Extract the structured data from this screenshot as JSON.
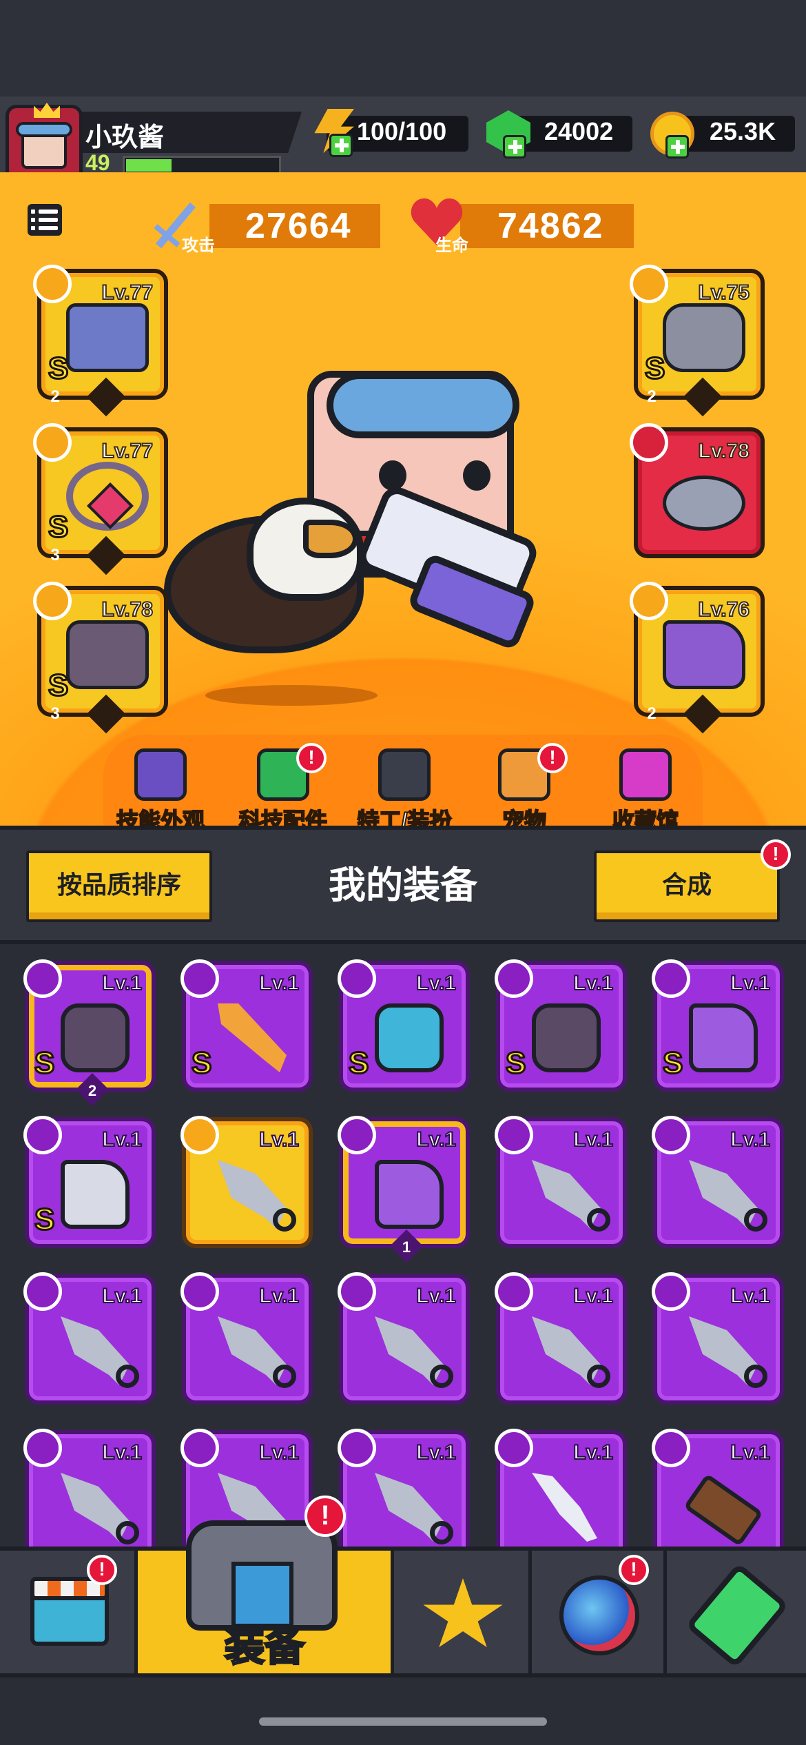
{
  "player": {
    "name": "小玖酱",
    "level": "49",
    "xp_fraction": 0.3
  },
  "resources": {
    "energy": "100/100",
    "gems": "24002",
    "coins": "25.3K"
  },
  "stats": {
    "attack_label": "攻击",
    "attack_value": "27664",
    "hp_label": "生命",
    "hp_value": "74862"
  },
  "equipped": [
    {
      "slot": "weapon",
      "level": "Lv.77",
      "rank": "S",
      "stars": "2",
      "frame": "yellow"
    },
    {
      "slot": "necklace",
      "level": "Lv.77",
      "rank": "S",
      "stars": "3",
      "frame": "yellow"
    },
    {
      "slot": "gloves",
      "level": "Lv.78",
      "rank": "S",
      "stars": "3",
      "frame": "yellow"
    },
    {
      "slot": "armor",
      "level": "Lv.75",
      "rank": "S",
      "stars": "2",
      "frame": "yellow"
    },
    {
      "slot": "belt",
      "level": "Lv.78",
      "rank": "",
      "stars": "",
      "frame": "red"
    },
    {
      "slot": "boots",
      "level": "Lv.76",
      "rank": "",
      "stars": "2",
      "frame": "yellow"
    }
  ],
  "features": [
    {
      "label": "技能外观",
      "icon": "skill-skin-icon",
      "alert": false
    },
    {
      "label": "科技配件",
      "icon": "tech-part-icon",
      "alert": true
    },
    {
      "label": "特工/装扮",
      "icon": "agent-icon",
      "alert": false
    },
    {
      "label": "宠物",
      "icon": "pet-icon",
      "alert": true
    },
    {
      "label": "收藏馆",
      "icon": "collection-icon",
      "alert": false
    }
  ],
  "equipment_panel": {
    "sort_button": "按品质排序",
    "title": "我的装备",
    "merge_button": "合成",
    "merge_alert": "!"
  },
  "inventory": [
    {
      "level": "Lv.1",
      "rank": "S",
      "stars": "2",
      "item": "gloves",
      "frame": "purple-gold"
    },
    {
      "level": "Lv.1",
      "rank": "S",
      "stars": "",
      "item": "sword",
      "frame": "purple"
    },
    {
      "level": "Lv.1",
      "rank": "S",
      "stars": "",
      "item": "armor",
      "frame": "purple"
    },
    {
      "level": "Lv.1",
      "rank": "S",
      "stars": "",
      "item": "gloves",
      "frame": "purple"
    },
    {
      "level": "Lv.1",
      "rank": "S",
      "stars": "",
      "item": "boots",
      "frame": "purple"
    },
    {
      "level": "Lv.1",
      "rank": "S",
      "stars": "",
      "item": "boots-white",
      "frame": "purple"
    },
    {
      "level": "Lv.1",
      "rank": "",
      "stars": "",
      "item": "kunai",
      "frame": "yellow"
    },
    {
      "level": "Lv.1",
      "rank": "",
      "stars": "1",
      "item": "boots",
      "frame": "purple-gold"
    },
    {
      "level": "Lv.1",
      "rank": "",
      "stars": "",
      "item": "kunai",
      "frame": "purple"
    },
    {
      "level": "Lv.1",
      "rank": "",
      "stars": "",
      "item": "kunai",
      "frame": "purple"
    },
    {
      "level": "Lv.1",
      "rank": "",
      "stars": "",
      "item": "kunai",
      "frame": "purple"
    },
    {
      "level": "Lv.1",
      "rank": "",
      "stars": "",
      "item": "kunai",
      "frame": "purple"
    },
    {
      "level": "Lv.1",
      "rank": "",
      "stars": "",
      "item": "kunai",
      "frame": "purple"
    },
    {
      "level": "Lv.1",
      "rank": "",
      "stars": "",
      "item": "kunai",
      "frame": "purple"
    },
    {
      "level": "Lv.1",
      "rank": "",
      "stars": "",
      "item": "kunai",
      "frame": "purple"
    },
    {
      "level": "Lv.1",
      "rank": "",
      "stars": "",
      "item": "kunai",
      "frame": "purple"
    },
    {
      "level": "Lv.1",
      "rank": "",
      "stars": "",
      "item": "kunai",
      "frame": "purple"
    },
    {
      "level": "Lv.1",
      "rank": "",
      "stars": "",
      "item": "kunai",
      "frame": "purple"
    },
    {
      "level": "Lv.1",
      "rank": "",
      "stars": "",
      "item": "blade",
      "frame": "purple"
    },
    {
      "level": "Lv.1",
      "rank": "",
      "stars": "",
      "item": "gun",
      "frame": "purple"
    }
  ],
  "nav": {
    "tabs": [
      {
        "name": "shop",
        "icon": "shop-icon",
        "alert": true
      },
      {
        "name": "equipment",
        "label": "装备",
        "icon": "equipment-icon",
        "alert": true,
        "active": true
      },
      {
        "name": "battle",
        "icon": "battle-icon",
        "alert": false
      },
      {
        "name": "events",
        "icon": "events-icon",
        "alert": true
      },
      {
        "name": "evolve",
        "icon": "evolve-icon",
        "alert": false
      }
    ]
  },
  "colors": {
    "stage_orange": "#ff8f10",
    "legendary_purple": "#9b30dc",
    "gold": "#f7c722",
    "alert_red": "#e5163a"
  }
}
